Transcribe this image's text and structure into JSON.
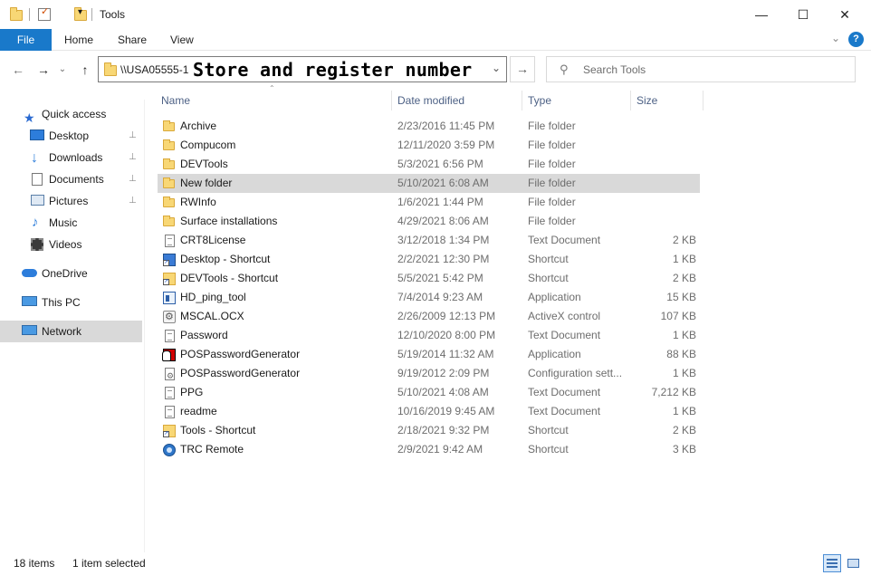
{
  "window": {
    "title": "Tools",
    "qat_dropdown_icon": "customize-quick-access-arrow",
    "controls": {
      "minimize": "—",
      "maximize": "☐",
      "close": "✕"
    }
  },
  "ribbon": {
    "tabs": [
      "File",
      "Home",
      "Share",
      "View"
    ],
    "expand_icon": "⌄",
    "help_icon": "?"
  },
  "address": {
    "path": "\\\\USA05555-1",
    "overlay_text": "Store and register number",
    "back": "←",
    "forward": "→",
    "recent": "⌄",
    "up": "↑",
    "dropdown": "⌄",
    "go": "→"
  },
  "search": {
    "placeholder": "Search Tools",
    "icon": "⚲"
  },
  "nav": {
    "items": [
      {
        "label": "Quick access",
        "icon": "star-icon"
      },
      {
        "label": "Desktop",
        "icon": "desktop-icon",
        "pinned": true
      },
      {
        "label": "Downloads",
        "icon": "download-icon",
        "pinned": true
      },
      {
        "label": "Documents",
        "icon": "documents-icon",
        "pinned": true
      },
      {
        "label": "Pictures",
        "icon": "pictures-icon",
        "pinned": true
      },
      {
        "label": "Music",
        "icon": "music-icon"
      },
      {
        "label": "Videos",
        "icon": "videos-icon"
      },
      {
        "label": "OneDrive",
        "icon": "cloud-icon"
      },
      {
        "label": "This PC",
        "icon": "computer-icon"
      },
      {
        "label": "Network",
        "icon": "network-icon",
        "selected": true
      }
    ],
    "pin_glyph": "📌"
  },
  "columns": {
    "name": "Name",
    "date": "Date modified",
    "type": "Type",
    "size": "Size",
    "sort_glyph": "⌃"
  },
  "files": [
    {
      "name": "Archive",
      "date": "2/23/2016 11:45 PM",
      "type": "File folder",
      "size": "",
      "icon": "folder"
    },
    {
      "name": "Compucom",
      "date": "12/11/2020 3:59 PM",
      "type": "File folder",
      "size": "",
      "icon": "folder"
    },
    {
      "name": "DEVTools",
      "date": "5/3/2021 6:56 PM",
      "type": "File folder",
      "size": "",
      "icon": "folder"
    },
    {
      "name": "New folder",
      "date": "5/10/2021 6:08 AM",
      "type": "File folder",
      "size": "",
      "icon": "folder",
      "selected": true
    },
    {
      "name": "RWInfo",
      "date": "1/6/2021 1:44 PM",
      "type": "File folder",
      "size": "",
      "icon": "folder"
    },
    {
      "name": "Surface installations",
      "date": "4/29/2021 8:06 AM",
      "type": "File folder",
      "size": "",
      "icon": "folder"
    },
    {
      "name": "CRT8License",
      "date": "3/12/2018 1:34 PM",
      "type": "Text Document",
      "size": "2 KB",
      "icon": "text"
    },
    {
      "name": "Desktop - Shortcut",
      "date": "2/2/2021 12:30 PM",
      "type": "Shortcut",
      "size": "1 KB",
      "icon": "shortcut"
    },
    {
      "name": "DEVTools - Shortcut",
      "date": "5/5/2021 5:42 PM",
      "type": "Shortcut",
      "size": "2 KB",
      "icon": "shortcut-folder"
    },
    {
      "name": "HD_ping_tool",
      "date": "7/4/2014 9:23 AM",
      "type": "Application",
      "size": "15 KB",
      "icon": "application"
    },
    {
      "name": "MSCAL.OCX",
      "date": "2/26/2009 12:13 PM",
      "type": "ActiveX control",
      "size": "107 KB",
      "icon": "activex"
    },
    {
      "name": "Password",
      "date": "12/10/2020 8:00 PM",
      "type": "Text Document",
      "size": "1 KB",
      "icon": "text"
    },
    {
      "name": "POSPasswordGenerator",
      "date": "5/19/2014 11:32 AM",
      "type": "Application",
      "size": "88 KB",
      "icon": "pos-application"
    },
    {
      "name": "POSPasswordGenerator",
      "date": "9/19/2012 2:09 PM",
      "type": "Configuration sett...",
      "size": "1 KB",
      "icon": "config"
    },
    {
      "name": "PPG",
      "date": "5/10/2021 4:08 AM",
      "type": "Text Document",
      "size": "7,212 KB",
      "icon": "text"
    },
    {
      "name": "readme",
      "date": "10/16/2019 9:45 AM",
      "type": "Text Document",
      "size": "1 KB",
      "icon": "text"
    },
    {
      "name": "Tools - Shortcut",
      "date": "2/18/2021 9:32 PM",
      "type": "Shortcut",
      "size": "2 KB",
      "icon": "shortcut-folder"
    },
    {
      "name": "TRC Remote",
      "date": "2/9/2021 9:42 AM",
      "type": "Shortcut",
      "size": "3 KB",
      "icon": "trc"
    }
  ],
  "status": {
    "count": "18 items",
    "selection": "1 item selected"
  },
  "colors": {
    "file_tab": "#1979ca",
    "selected_row": "#d9d9d9",
    "header_text": "#4d6185",
    "help": "#1979ca"
  }
}
